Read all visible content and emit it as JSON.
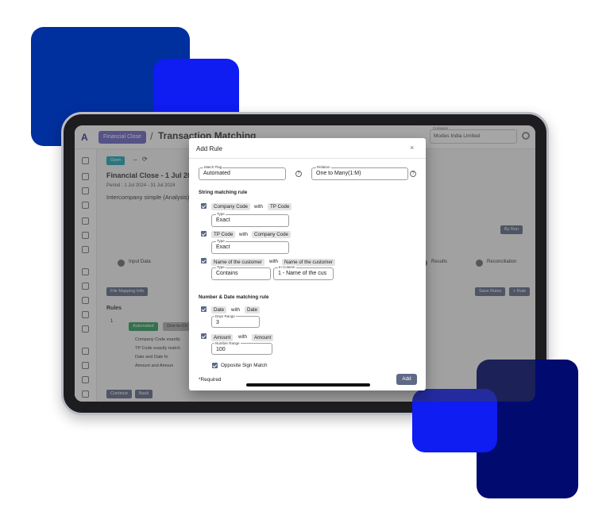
{
  "app": {
    "breadcrumb_button": "Financial Close",
    "separator": "/",
    "page_title": "Transaction Matching",
    "company_label": "Company",
    "company_value": "Modes India Limited",
    "status_tag": "Open",
    "close_title": "Financial Close - 1 Jul 2024 to",
    "period": "Period : 1 Jul 2024 - 31 Jul 2024",
    "subtitle": "Intercompany simple (Analysis)",
    "steps": [
      "Input Data",
      "Results",
      "Reconciliation"
    ],
    "buttons": {
      "file_mapping": "File Mapping Info",
      "by_run": "By Run",
      "save_rules": "Save Rules",
      "add_rule": "+ Rule",
      "continue": "Continue",
      "back": "Back"
    },
    "rules_heading": "Rules",
    "rule_number": "1",
    "rule_tags": [
      "Automated",
      "One-to-Ch"
    ],
    "rule_lines": [
      {
        "a": "Company Code",
        "t": "exactly"
      },
      {
        "a": "TP Code",
        "t": "exactly match"
      },
      {
        "a": "Date",
        "t": "and",
        "b": "Date",
        "c": "fo"
      },
      {
        "a": "Amount",
        "t": "and",
        "b": "Amoun"
      }
    ]
  },
  "modal": {
    "title": "Add Rule",
    "close": "×",
    "match_flag_label": "Match Flag",
    "match_flag_value": "Automated",
    "relation_label": "Relation",
    "relation_value": "One to Many(1:M)",
    "help_glyph": "?",
    "string_section": "String matching rule",
    "with_word": "with",
    "type_label": "Type",
    "in_column_label": "In Column",
    "string_rules": [
      {
        "left": "Company Code",
        "right": "TP Code",
        "type": "Exact",
        "checked": true
      },
      {
        "left": "TP Code",
        "right": "Company Code",
        "type": "Exact",
        "checked": true
      },
      {
        "left": "Name of the customer",
        "right": "Name of the customer",
        "type": "Contains",
        "in_column": "1 - Name of the cus",
        "checked": true
      }
    ],
    "number_section": "Number & Date matching rule",
    "date_rule": {
      "left": "Date",
      "right": "Date",
      "range_label": "Days Range",
      "range_value": "3",
      "checked": true
    },
    "amount_rule": {
      "left": "Amount",
      "right": "Amount",
      "range_label": "Number Range",
      "range_value": "100",
      "checked": true
    },
    "opposite_sign_label": "Opposite Sign Match",
    "opposite_sign_checked": true,
    "required_note": "*Required",
    "add_button": "Add"
  },
  "colors": {
    "deco_dark_blue": "#002f9e",
    "deco_bright_blue": "#0f1cf2",
    "deco_navy": "#010a6e",
    "accent": "#5e6a86",
    "tag_green": "#2e9e5c",
    "breadcrumb": "#6a64c8",
    "open_tag": "#18a8b8"
  }
}
